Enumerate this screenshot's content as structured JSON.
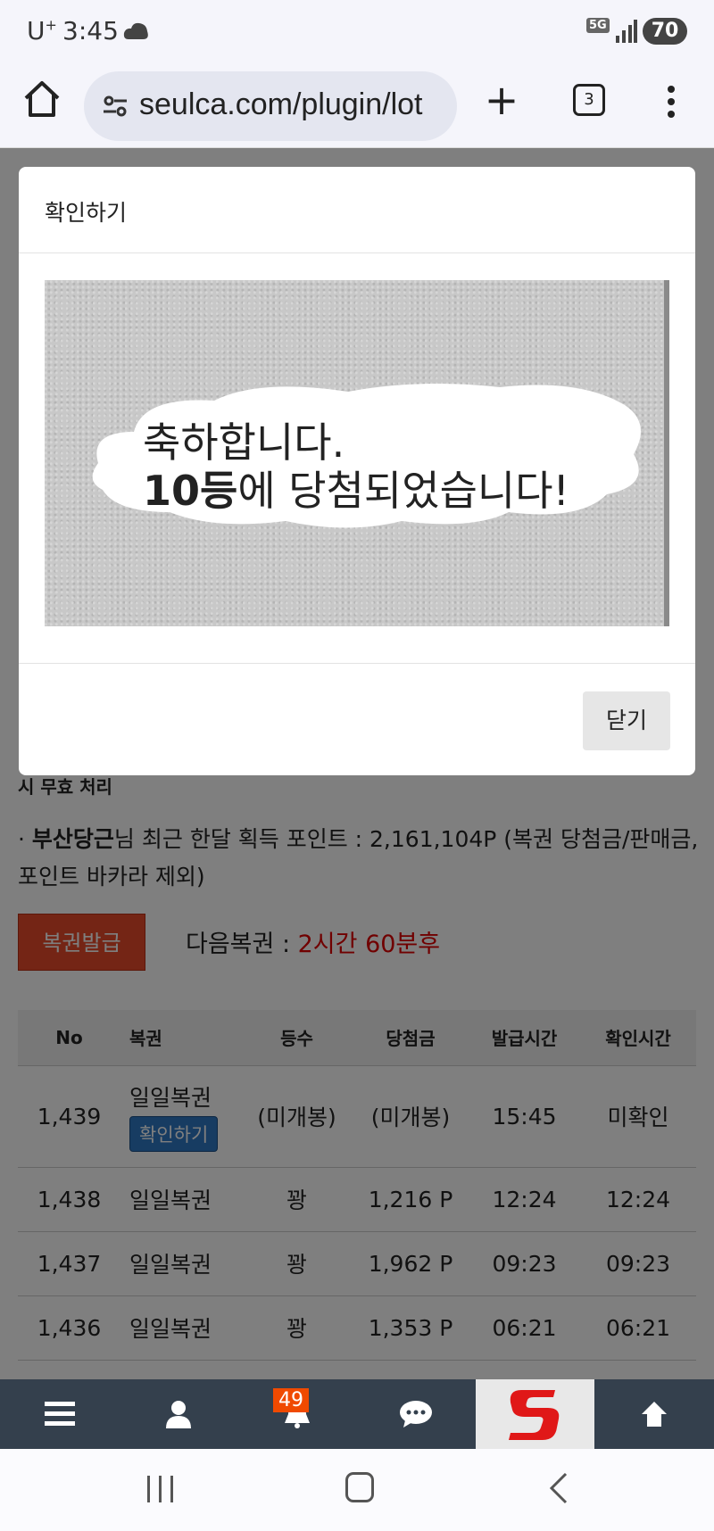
{
  "status_bar": {
    "carrier": "U",
    "carrier_sup": "+",
    "time": "3:45",
    "network": "5G",
    "battery": "70"
  },
  "browser": {
    "url": "seulca.com/plugin/lot",
    "tab_count": "3"
  },
  "page": {
    "notice_text": "시 무효 처리",
    "points_line": {
      "prefix": "· ",
      "user": "부산당근",
      "text": "님 최근 한달 획득 포인트 : 2,161,104P (복권 당첨금/판매금, 포인트 바카라 제외)"
    },
    "issue_button": "복권발급",
    "next_ticket_label": "다음복권 : ",
    "next_ticket_value": "2시간 60분후",
    "table": {
      "headers": [
        "No",
        "복권",
        "등수",
        "당첨금",
        "발급시간",
        "확인시간"
      ],
      "rows": [
        {
          "no": "1,439",
          "ticket": "일일복권",
          "badge": "확인하기",
          "rank": "(미개봉)",
          "prize": "(미개봉)",
          "issued": "15:45",
          "checked": "미확인"
        },
        {
          "no": "1,438",
          "ticket": "일일복권",
          "rank": "꽝",
          "prize": "1,216 P",
          "issued": "12:24",
          "checked": "12:24"
        },
        {
          "no": "1,437",
          "ticket": "일일복권",
          "rank": "꽝",
          "prize": "1,962 P",
          "issued": "09:23",
          "checked": "09:23"
        },
        {
          "no": "1,436",
          "ticket": "일일복권",
          "rank": "꽝",
          "prize": "1,353 P",
          "issued": "06:21",
          "checked": "06:21"
        }
      ]
    }
  },
  "modal": {
    "title": "확인하기",
    "message_line1": "축하합니다.",
    "message_rank": "10등",
    "message_line2_rest": "에 당첨되었습니다!",
    "close_button": "닫기"
  },
  "site_nav": {
    "notification_count": "49"
  },
  "colors": {
    "accent_red": "#e84a2a",
    "link_blue": "#2f78c4",
    "warning_orange": "#f0a000",
    "nav_bg": "#34404d"
  }
}
